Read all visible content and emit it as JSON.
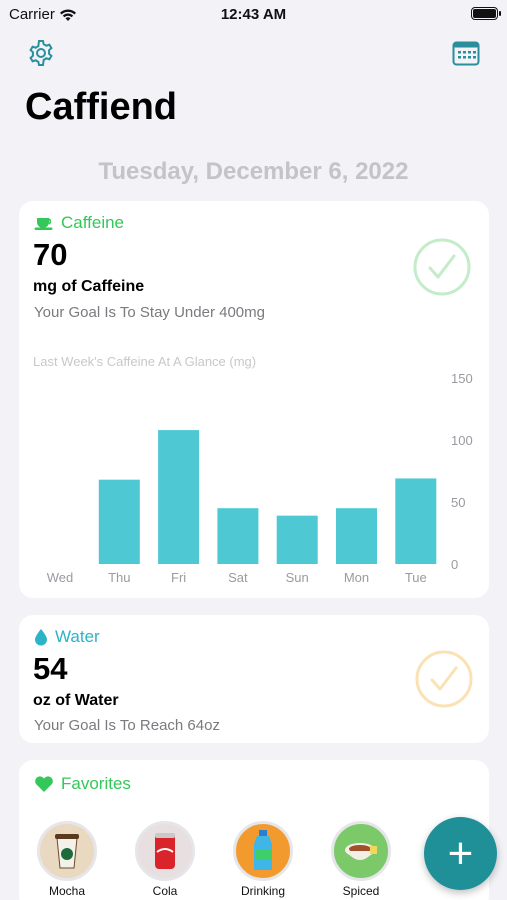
{
  "status_bar": {
    "carrier": "Carrier",
    "time": "12:43 AM"
  },
  "header": {
    "title": "Caffiend",
    "settings_icon": "gear-icon",
    "calendar_icon": "calendar-icon"
  },
  "date": "Tuesday, December 6, 2022",
  "caffeine": {
    "label": "Caffeine",
    "amount": "70",
    "unit": "mg of Caffeine",
    "goal": "Your Goal Is To Stay Under 400mg",
    "accent": "#34c759",
    "check_color": "#c4ecc9"
  },
  "chart_data": {
    "type": "bar",
    "title": "Last Week's Caffeine At A Glance (mg)",
    "categories": [
      "Wed",
      "Thu",
      "Fri",
      "Sat",
      "Sun",
      "Mon",
      "Tue"
    ],
    "values": [
      0,
      68,
      108,
      45,
      39,
      45,
      69
    ],
    "ylim": [
      0,
      150
    ],
    "yticks": [
      "0",
      "50",
      "100",
      "150"
    ],
    "bar_color": "#4ec9d4"
  },
  "water": {
    "label": "Water",
    "amount": "54",
    "unit": "oz of Water",
    "goal": "Your Goal Is To Reach  64oz",
    "accent": "#2bb3c8",
    "check_color": "#fbe2b4"
  },
  "favorites": {
    "label": "Favorites",
    "accent": "#34c759",
    "items": [
      {
        "label": "Mocha",
        "icon": "coffee-cup-icon"
      },
      {
        "label": "Cola",
        "icon": "soda-can-icon"
      },
      {
        "label": "Drinking",
        "icon": "water-bottle-icon"
      },
      {
        "label": "Spiced",
        "icon": "tea-cup-icon"
      }
    ]
  },
  "add_button": {
    "label": "+"
  }
}
